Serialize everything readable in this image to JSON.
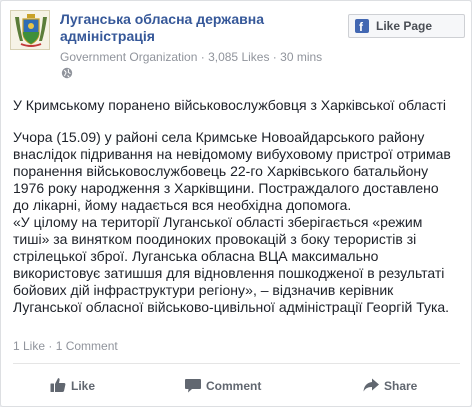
{
  "header": {
    "page_name": "Луганська обласна державна адміністрація",
    "category": "Government Organization",
    "likes": "3,085 Likes",
    "time": "30 mins",
    "separator": " · ",
    "like_page_label": "Like Page",
    "like_page_icon": "facebook-f-icon",
    "privacy_icon": "globe-icon"
  },
  "post": {
    "headline": "У Кримському поранено військовослужбовця з Харківської області",
    "body": "Учора (15.09) у районі села Кримське Новоайдарського району\nвнаслідок підривання на невідомому вибуховому пристрої отримав\nпоранення військовослужбовець 22-го Харківського батальйону\n1976 року народження з Харківщини. Постраждалого доставлено\nдо лікарні, йому надається вся необхідна допомога.\n«У цілому на території Луганської області зберігається «режим\nтиші» за винятком поодиноких провокацій з боку терористів зі\nстрілецької зброї. Луганська обласна ВЦА максимально\nвикористовує затишшя для відновлення пошкодженої в результаті\nбойових дій інфраструктури регіону», – відзначив керівник\nЛуганської обласної військово-цивільної адміністрації Георгій Тука."
  },
  "stats": {
    "likes": "1 Like",
    "comments": "1 Comment",
    "separator": " · "
  },
  "actions": {
    "like": "Like",
    "comment": "Comment",
    "share": "Share"
  },
  "colors": {
    "link": "#365899",
    "meta": "#90949c",
    "facebook_blue": "#4267b2",
    "action_text": "#616770"
  }
}
